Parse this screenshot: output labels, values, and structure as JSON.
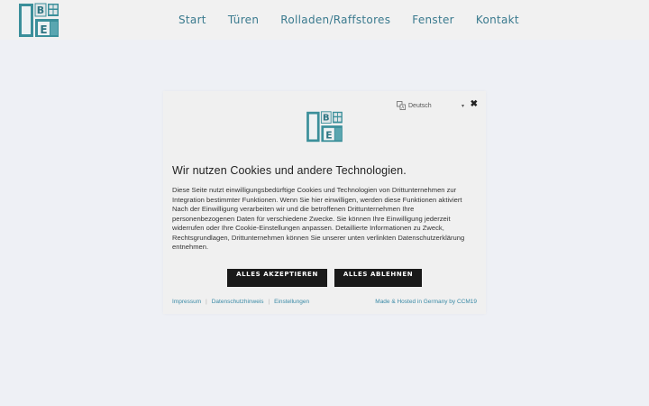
{
  "header": {
    "nav": [
      "Start",
      "Türen",
      "Rolladen/Raffstores",
      "Fenster",
      "Kontakt"
    ]
  },
  "logo": {
    "letters": [
      "B",
      "E"
    ]
  },
  "dialog": {
    "language": "Deutsch",
    "title": "Wir nutzen Cookies und andere Technologien.",
    "body": "Diese Seite nutzt einwilligungsbedürftige Cookies und Technologien von Drittunternehmen zur Integration bestimmter Funktionen. Wenn Sie hier einwilligen, werden diese Funktionen aktiviert Nach der Einwilligung verarbeiten wir und die betroffenen Drittunternehmen Ihre personenbezogenen Daten für verschiedene Zwecke. Sie können Ihre Einwilligung jederzeit widerrufen oder Ihre Cookie-Einstellungen anpassen. Detaillierte Informationen zu Zweck, Rechtsgrundlagen, Drittunternehmen können Sie unserer unten verlinkten Datenschutzerklärung entnehmen.",
    "accept_label": "ALLES AKZEPTIEREN",
    "reject_label": "ALLES ABLEHNEN",
    "footer_links": [
      "Impressum",
      "Datenschutzhinweis",
      "Einstellungen"
    ],
    "credit": "Made & Hosted in Germany by CCM19"
  },
  "colors": {
    "nav_link": "#3a7a8e",
    "logo_teal": "#3b8f9a",
    "button_bg": "#1a1a1a",
    "link": "#3a8aa6"
  }
}
